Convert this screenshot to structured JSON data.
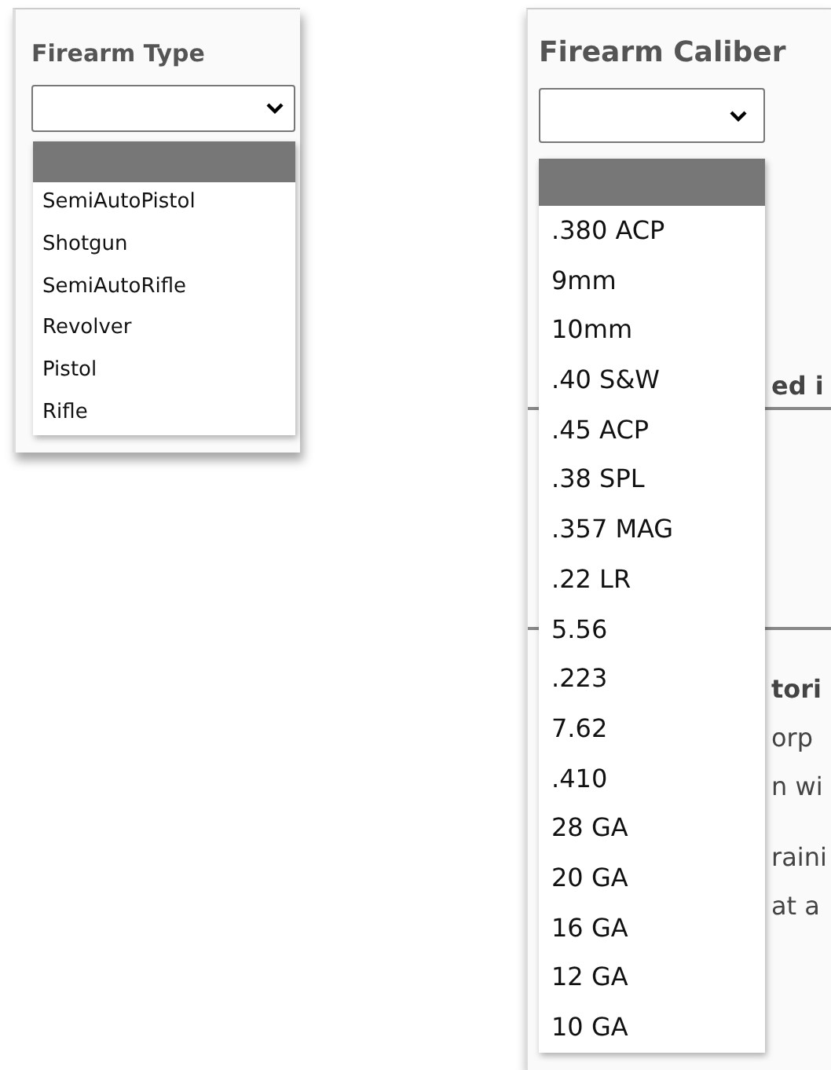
{
  "firearm_type": {
    "label": "Firearm Type",
    "dropdown": {
      "blank_highlighted": true,
      "options": [
        {
          "label": "SemiAutoPistol",
          "selected": false
        },
        {
          "label": "Shotgun",
          "selected": false
        },
        {
          "label": "SemiAutoRifle",
          "selected": false
        },
        {
          "label": "Revolver",
          "selected": false
        },
        {
          "label": "Pistol",
          "selected": false
        },
        {
          "label": "Rifle",
          "selected": false
        }
      ]
    }
  },
  "firearm_caliber": {
    "label": "Firearm Caliber",
    "background_text": [
      {
        "right": "ed i",
        "bold": true
      },
      {
        "right": "tori",
        "bold": true
      },
      {
        "right": "orp",
        "bold": false
      },
      {
        "right": "n wi",
        "bold": false
      },
      {
        "right": "raini",
        "bold": false
      },
      {
        "right": "at a",
        "bold": false
      }
    ],
    "dropdown": {
      "blank_highlighted": true,
      "options": [
        {
          "label": ".380 ACP",
          "selected": false
        },
        {
          "label": "9mm",
          "selected": false
        },
        {
          "label": "10mm",
          "selected": false
        },
        {
          "label": ".40 S&W",
          "selected": false
        },
        {
          "label": ".45 ACP",
          "selected": false
        },
        {
          "label": ".38 SPL",
          "selected": false
        },
        {
          "label": ".357 MAG",
          "selected": false
        },
        {
          "label": ".22 LR",
          "selected": false
        },
        {
          "label": "5.56",
          "selected": false
        },
        {
          "label": ".223",
          "selected": false
        },
        {
          "label": "7.62",
          "selected": false
        },
        {
          "label": ".410",
          "selected": false
        },
        {
          "label": "28 GA",
          "selected": false
        },
        {
          "label": "20 GA",
          "selected": false
        },
        {
          "label": "16 GA",
          "selected": false
        },
        {
          "label": "12 GA",
          "selected": false
        },
        {
          "label": "10 GA",
          "selected": false
        }
      ]
    }
  }
}
